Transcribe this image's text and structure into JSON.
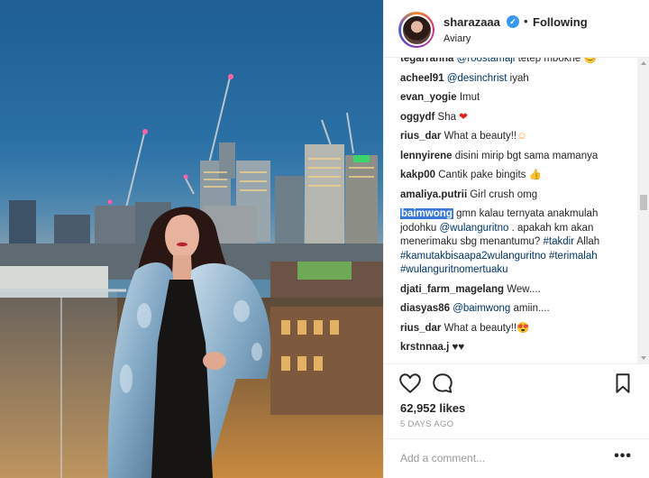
{
  "header": {
    "username": "sharazaaa",
    "verified_glyph": "✓",
    "separator": "•",
    "follow_status": "Following",
    "location": "Aviary"
  },
  "comments": [
    {
      "user": "tegarranna",
      "mention": "@roostamaji",
      "text": " tetep mbokne 😊"
    },
    {
      "user": "acheel91",
      "mention": "@desinchrist",
      "text": " iyah"
    },
    {
      "user": "evan_yogie",
      "mention": "",
      "text": "Imut"
    },
    {
      "user": "oggydf",
      "mention": "",
      "text": "Sha ",
      "emoji": "❤"
    },
    {
      "user": "rius_dar",
      "mention": "",
      "text": "What a beauty!!",
      "emoji": "☺"
    },
    {
      "user": "lennyirene",
      "mention": "",
      "text": "disini mirip bgt sama mamanya"
    },
    {
      "user": "kakp00",
      "mention": "",
      "text": "Cantik pake bingits ",
      "emoji": "👍"
    },
    {
      "user": "amaliya.putrii",
      "mention": "",
      "text": "Girl crush omg"
    },
    {
      "user": "baimwong",
      "selected": true,
      "parts": [
        "gmn kalau ternyata anakmulah jodohku ",
        "@wulanguritno",
        " . apakah km akan menerimaku sbg menantumu? ",
        "#takdir",
        " Allah ",
        "#kamutakbisaapa2wulanguritno",
        " ",
        "#terimalah",
        " ",
        "#wulanguritnomertuaku"
      ]
    },
    {
      "user": "djati_farm_magelang",
      "mention": "",
      "text": "Wew...."
    },
    {
      "user": "diasyas86",
      "mention": "@baimwong",
      "text": " amiin...."
    },
    {
      "user": "rius_dar",
      "mention": "",
      "text": "What a beauty!!",
      "emoji": "😍"
    },
    {
      "user": "krstnnaa.j",
      "mention": "",
      "text": "",
      "emoji": "♥♥"
    }
  ],
  "actions": {
    "like_icon": "heart-outline-icon",
    "comment_icon": "speech-bubble-icon",
    "save_icon": "bookmark-icon"
  },
  "likes": "62,952 likes",
  "timestamp": "5 DAYS AGO",
  "comment_input": {
    "placeholder": "Add a comment...",
    "more": "•••"
  }
}
